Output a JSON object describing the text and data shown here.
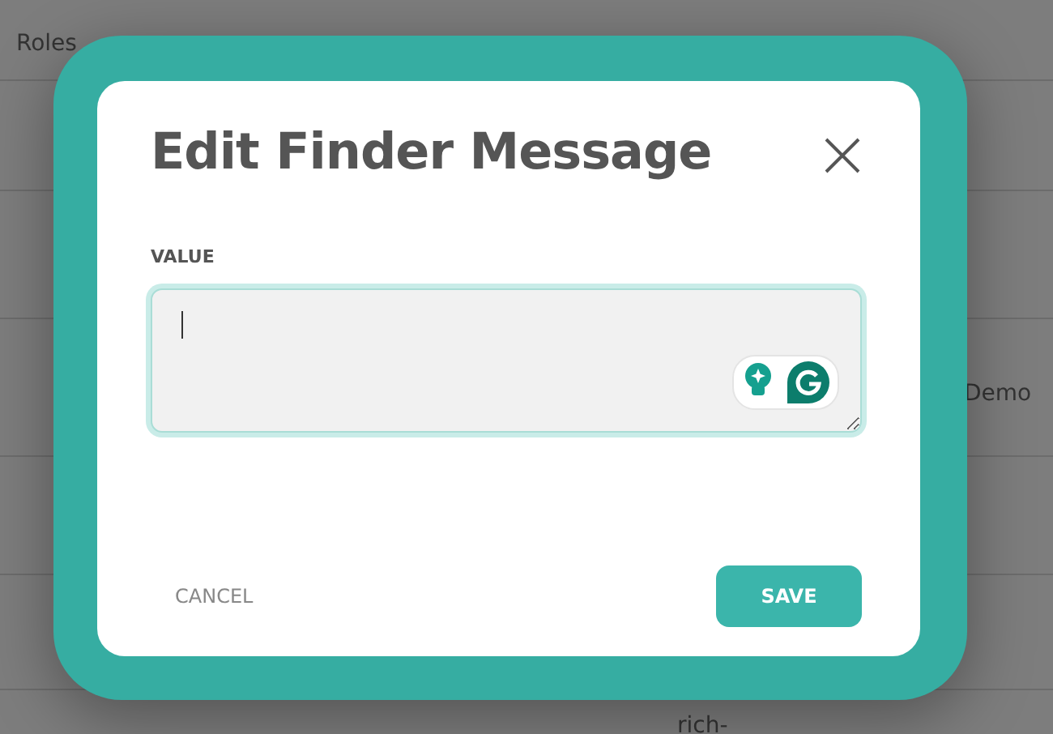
{
  "background_table": {
    "header": [
      "Roles"
    ],
    "cells": [
      "Demo",
      "rich-"
    ]
  },
  "dialog": {
    "title": "Edit Finder Message",
    "field": {
      "label": "VALUE",
      "focused": true
    },
    "buttons": [
      {
        "label": "CANCEL",
        "kind": "text"
      },
      {
        "label": "SAVE",
        "kind": "primary"
      }
    ]
  }
}
